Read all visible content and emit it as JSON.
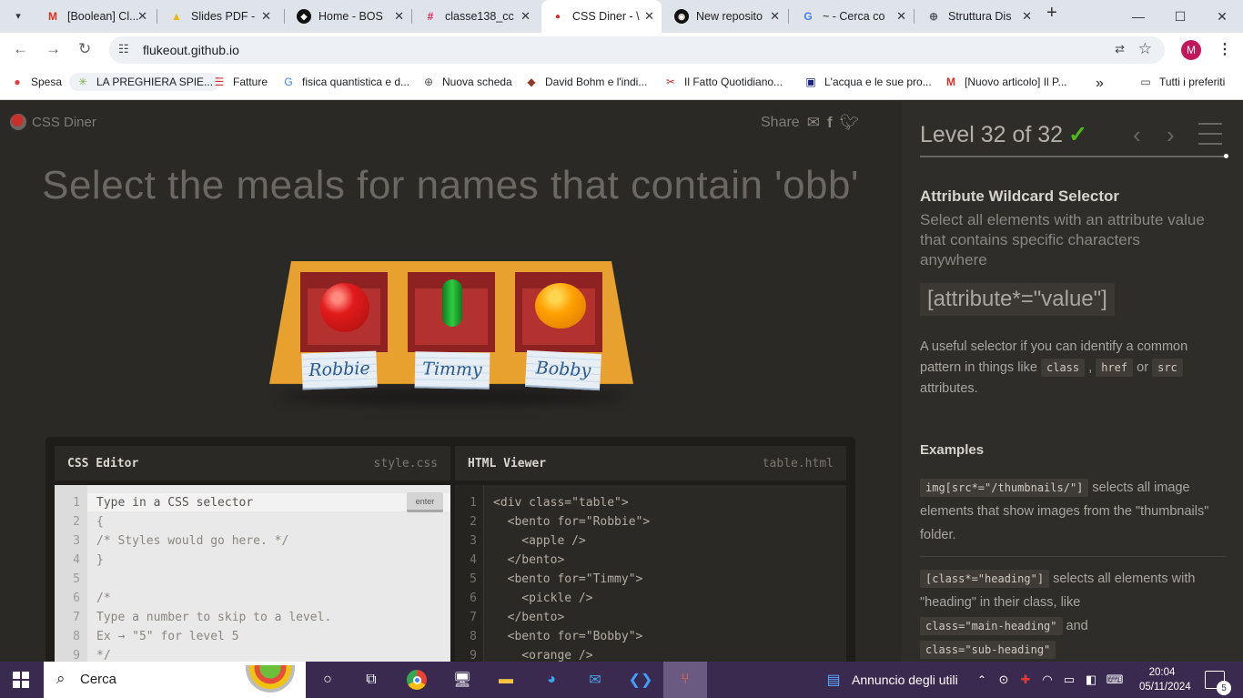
{
  "browser": {
    "tabs": [
      {
        "title": "[Boolean] Cl...",
        "favicon": "gmail-icon"
      },
      {
        "title": "Slides PDF -",
        "favicon": "drive-icon"
      },
      {
        "title": "Home - BOS",
        "favicon": "bos-icon"
      },
      {
        "title": "classe138_cc",
        "favicon": "slack-icon"
      },
      {
        "title": "CSS Diner - \\",
        "favicon": "css-diner-icon"
      },
      {
        "title": "New reposito",
        "favicon": "github-icon"
      },
      {
        "title": "~ - Cerca co",
        "favicon": "google-icon"
      },
      {
        "title": "Struttura Dis",
        "favicon": "globe-icon"
      }
    ],
    "url": "flukeout.github.io",
    "avatar_letter": "M",
    "bookmarks": [
      {
        "label": "Spesa"
      },
      {
        "label": "LA PREGHIERA SPIE..."
      },
      {
        "label": "Fatture"
      },
      {
        "label": "fisica quantistica e d..."
      },
      {
        "label": "Nuova scheda"
      },
      {
        "label": "David Bohm e l'indi..."
      },
      {
        "label": "Il Fatto Quotidiano..."
      },
      {
        "label": "L'acqua e le sue pro..."
      },
      {
        "label": "[Nuovo articolo] Il P..."
      },
      {
        "label": "Tutti i preferiti"
      }
    ],
    "more_bookmarks": "»"
  },
  "app": {
    "logo_text": "CSS Diner",
    "share_label": "Share",
    "instruction": "Select the meals for names that contain 'obb'",
    "bentos": [
      {
        "name": "Robbie",
        "food": "apple"
      },
      {
        "name": "Timmy",
        "food": "pickle"
      },
      {
        "name": "Bobby",
        "food": "orange"
      }
    ],
    "css_editor": {
      "title": "CSS Editor",
      "file": "style.css",
      "enter_label": "enter",
      "lines": [
        {
          "n": "1",
          "text": "Type in a CSS selector"
        },
        {
          "n": "2",
          "text": "{"
        },
        {
          "n": "3",
          "text": "/* Styles would go here. */"
        },
        {
          "n": "4",
          "text": "}"
        },
        {
          "n": "5",
          "text": ""
        },
        {
          "n": "6",
          "text": "/*"
        },
        {
          "n": "7",
          "text": "Type a number to skip to a level."
        },
        {
          "n": "8",
          "text": "Ex → \"5\" for level 5"
        },
        {
          "n": "9",
          "text": "*/"
        }
      ]
    },
    "html_viewer": {
      "title": "HTML Viewer",
      "file": "table.html",
      "lines": [
        {
          "n": "1",
          "text": "<div class=\"table\">"
        },
        {
          "n": "2",
          "text": "  <bento for=\"Robbie\">"
        },
        {
          "n": "3",
          "text": "    <apple />"
        },
        {
          "n": "4",
          "text": "  </bento>"
        },
        {
          "n": "5",
          "text": "  <bento for=\"Timmy\">"
        },
        {
          "n": "6",
          "text": "    <pickle />"
        },
        {
          "n": "7",
          "text": "  </bento>"
        },
        {
          "n": "8",
          "text": "  <bento for=\"Bobby\">"
        },
        {
          "n": "9",
          "text": "    <orange />"
        }
      ]
    }
  },
  "sidebar": {
    "level_text": "Level 32 of 32",
    "level_complete_icon": "✓",
    "heading": "Attribute Wildcard Selector",
    "subheading": "Select all elements with an attribute value that contains specific characters anywhere",
    "syntax": "[attribute*=\"value\"]",
    "desc_1": "A useful selector if you can identify a common pattern in things like",
    "code_class": "class",
    "code_href": "href",
    "desc_or": "or",
    "code_src": "src",
    "desc_2": "attributes.",
    "examples_heading": "Examples",
    "ex1_code": "img[src*=\"/thumbnails/\"]",
    "ex1_text": "selects all image elements that show images from the \"thumbnails\" folder.",
    "ex2_code": "[class*=\"heading\"]",
    "ex2_text_a": "selects all elements with \"heading\" in their class, like",
    "ex2_code_b": "class=\"main-heading\"",
    "ex2_and": "and",
    "ex2_code_c": "class=\"sub-heading\""
  },
  "taskbar": {
    "search_placeholder": "Cerca",
    "news_text": "Annuncio degli utili",
    "time": "20:04",
    "date": "05/11/2024",
    "notifications": "5"
  },
  "colors": {
    "accent_green": "#4cbb17",
    "page_bg": "#2b2926",
    "sidebar_bg": "#2f2d2a",
    "taskbar_bg": "#3a2a50"
  }
}
